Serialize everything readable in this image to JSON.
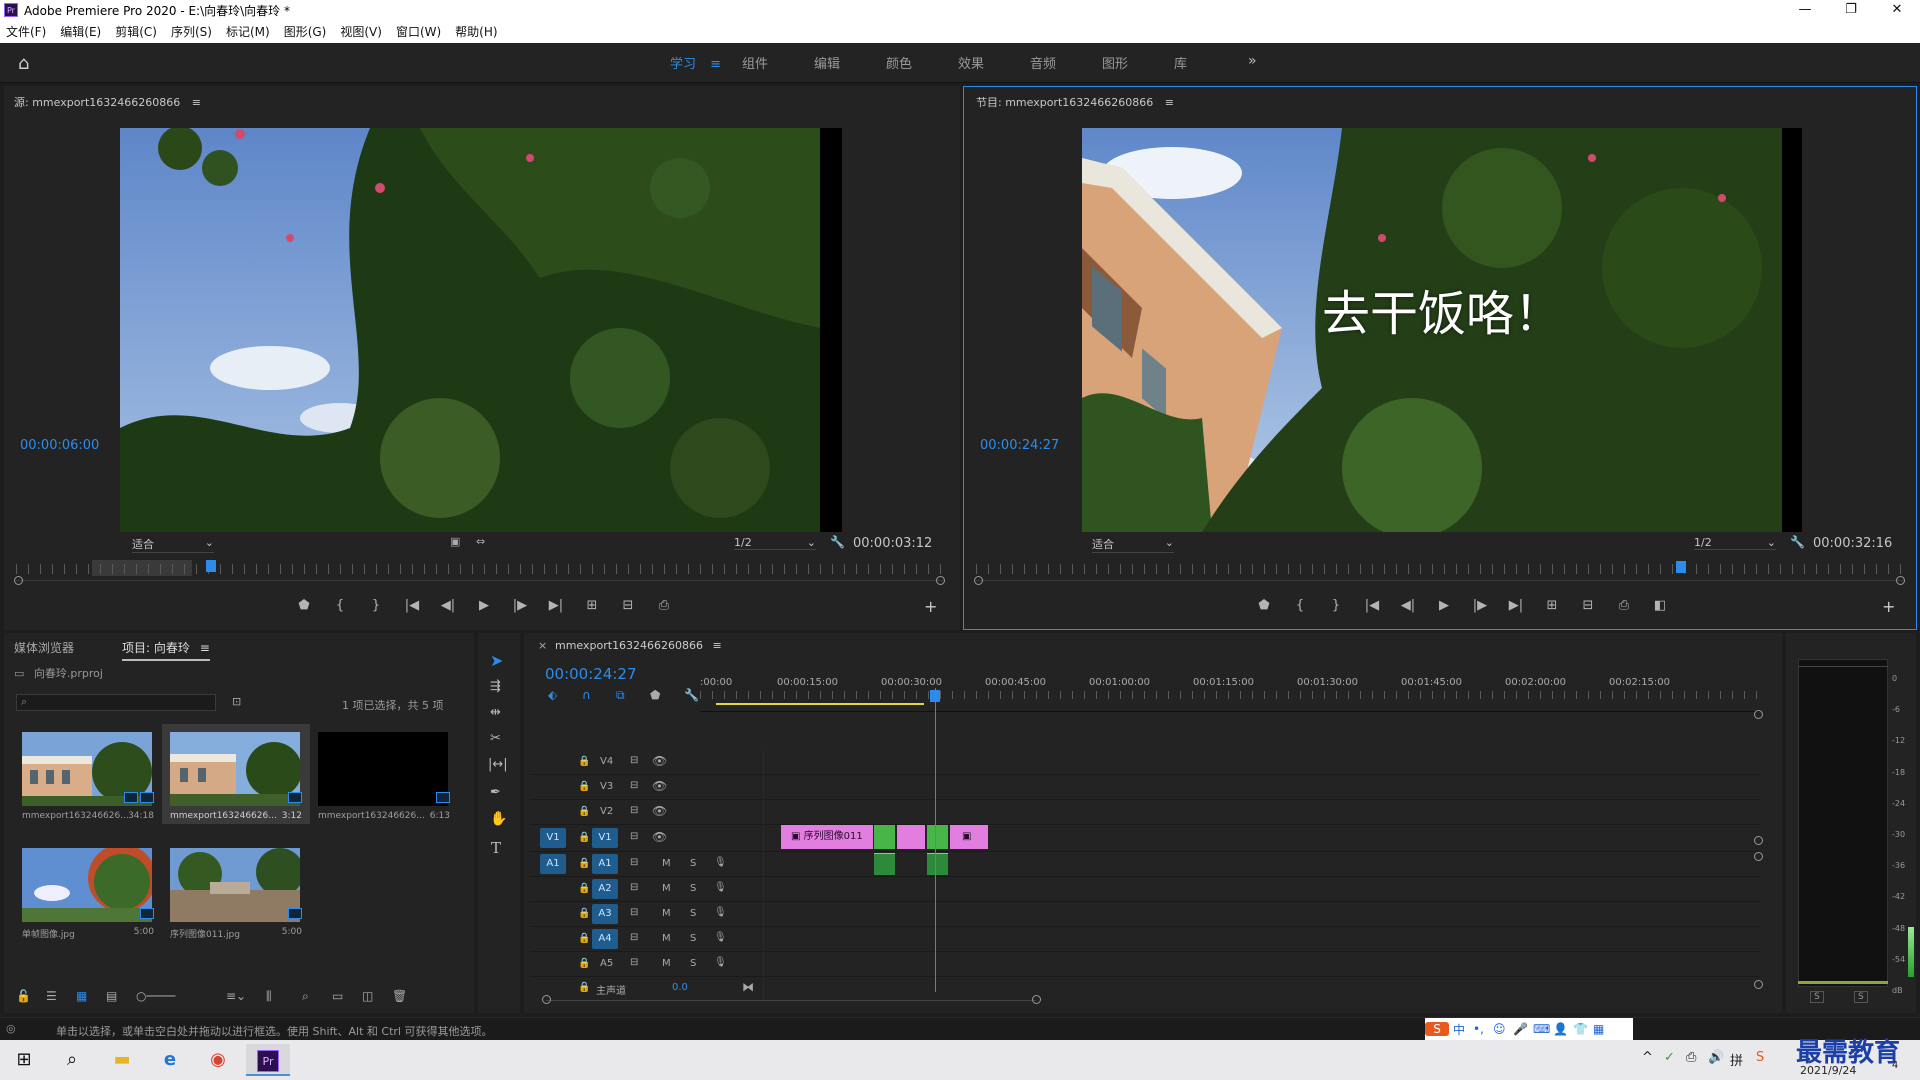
{
  "window": {
    "title": "Adobe Premiere Pro 2020 - E:\\向春玲\\向春玲 *",
    "controls": [
      "—",
      "❐",
      "✕"
    ],
    "app_icon": "Pr"
  },
  "menu": [
    "文件(F)",
    "编辑(E)",
    "剪辑(C)",
    "序列(S)",
    "标记(M)",
    "图形(G)",
    "视图(V)",
    "窗口(W)",
    "帮助(H)"
  ],
  "workspaces": {
    "tabs": [
      "学习",
      "组件",
      "编辑",
      "颜色",
      "效果",
      "音频",
      "图形",
      "库"
    ],
    "active": "学习",
    "menu_icon": "≡",
    "more": "»"
  },
  "source": {
    "title": "源: mmexport1632466260866",
    "menu_icon": "≡",
    "timecode": "00:00:06:00",
    "fit": "适合",
    "resolution": "1/2",
    "duration": "00:00:03:12",
    "playhead_fraction": 0.21
  },
  "program": {
    "title": "节目: mmexport1632466260866",
    "menu_icon": "≡",
    "timecode": "00:00:24:27",
    "fit": "适合",
    "resolution": "1/2",
    "duration": "00:00:32:16",
    "caption": "去干饭咯！",
    "playhead_fraction": 0.76
  },
  "project": {
    "tabs": [
      "媒体浏览器",
      "项目: 向春玲"
    ],
    "active_tab": "项目: 向春玲",
    "menu_icon": "≡",
    "file": "向春玲.prproj",
    "search_placeholder": "",
    "selection_status": "1 项已选择，共 5 项",
    "items": [
      {
        "name": "mmexport163246626...",
        "duration": "34:18"
      },
      {
        "name": "mmexport163246626...",
        "duration": "3:12"
      },
      {
        "name": "mmexport163246626...",
        "duration": "6:13"
      },
      {
        "name": "单帧图像.jpg",
        "duration": "5:00"
      },
      {
        "name": "序列图像011.jpg",
        "duration": "5:00"
      }
    ]
  },
  "tools": [
    "selection-tool",
    "track-select-tool",
    "ripple-edit-tool",
    "razor-tool",
    "slip-tool",
    "pen-tool",
    "hand-tool",
    "type-tool"
  ],
  "timeline": {
    "sequence": "mmexport1632466260866",
    "close": "×",
    "menu_icon": "≡",
    "timecode": "00:00:24:27",
    "ruler_labels": [
      ":00:00",
      "00:00:15:00",
      "00:00:30:00",
      "00:00:45:00",
      "00:01:00:00",
      "00:01:15:00",
      "00:01:30:00",
      "00:01:45:00",
      "00:02:00:00",
      "00:02:15:00"
    ],
    "video_tracks": [
      "V4",
      "V3",
      "V2",
      "V1"
    ],
    "audio_tracks": [
      "A1",
      "A2",
      "A3",
      "A4",
      "A5"
    ],
    "source_v": "V1",
    "source_a": "A1",
    "mute": "M",
    "solo": "S",
    "master_label": "主声道",
    "master_value": "0.0",
    "clip_label": "序列图像011",
    "playhead_fraction": 0.127
  },
  "meter": {
    "scale": [
      "0",
      "-6",
      "-12",
      "-18",
      "-24",
      "-30",
      "-36",
      "-42",
      "-48",
      "-54",
      "dB"
    ],
    "solo": [
      "S",
      "S"
    ]
  },
  "status_bar": "单击以选择，或单击空白处并拖动以进行框选。使用 Shift、Alt 和 Ctrl 可获得其他选项。",
  "ime": [
    "S",
    "中",
    "•,",
    "☺",
    "🎤",
    "⌨",
    "👤",
    "👕",
    "▦"
  ],
  "taskbar": {
    "date": "2021/9/24",
    "watermark": "最需教育",
    "tray": [
      "^",
      "✓",
      "⎙",
      "🔊",
      "拼",
      "S"
    ],
    "notifications": "4"
  }
}
